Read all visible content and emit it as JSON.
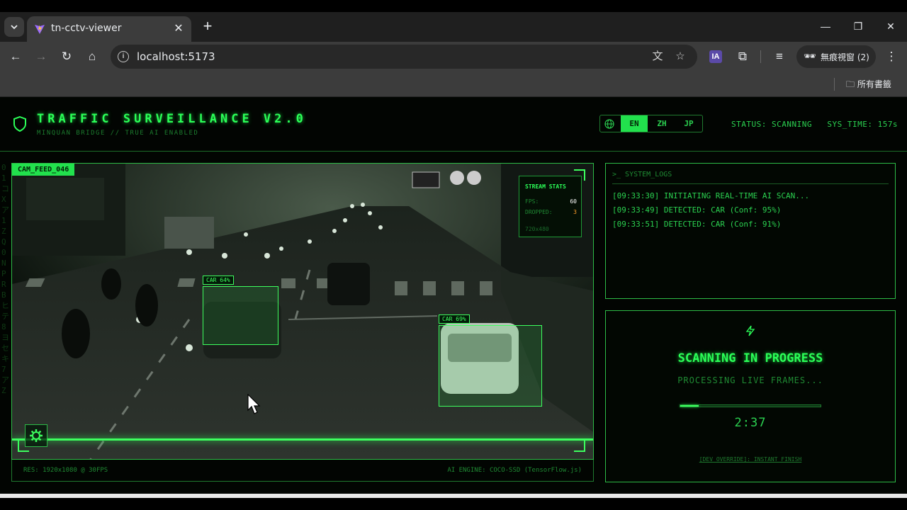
{
  "browser": {
    "tab_title": "tn-cctv-viewer",
    "url": "localhost:5173",
    "incognito_label": "無痕視窗 (2)",
    "bookmarks_label": "所有書籤",
    "extension_label": "IA"
  },
  "header": {
    "title": "TRAFFIC SURVEILLANCE V2.0",
    "subtitle": "MINQUAN BRIDGE // TRUE AI ENABLED",
    "languages": [
      "EN",
      "ZH",
      "JP"
    ],
    "active_language": "EN",
    "status": "STATUS: SCANNING",
    "sys_time": "SYS_TIME: 157s"
  },
  "video": {
    "cam_label": "CAM_FEED_046",
    "stream_stats": {
      "title": "STREAM STATS",
      "fps_label": "FPS:",
      "fps_value": "60",
      "dropped_label": "DROPPED:",
      "dropped_value": "3",
      "resolution": "720x480"
    },
    "detections": [
      {
        "label": "CAR 64%"
      },
      {
        "label": "CAR 69%"
      }
    ],
    "footer_left": "RES: 1920x1080 @ 30FPS",
    "footer_right": "AI ENGINE: COCO-SSD (TensorFlow.js)"
  },
  "logs": {
    "title": ">_ SYSTEM_LOGS",
    "lines": [
      "[09:33:30] INITIATING REAL-TIME AI SCAN...",
      "[09:33:49] DETECTED: CAR (Conf: 95%)",
      "[09:33:51] DETECTED: CAR (Conf: 91%)"
    ]
  },
  "scan": {
    "title": "SCANNING IN PROGRESS",
    "subtitle": "PROCESSING LIVE FRAMES...",
    "progress": 0.13,
    "countdown": "2:37",
    "dev_override": "[DEV_OVERRIDE]: INSTANT_FINISH"
  },
  "colors": {
    "accent": "#2bff58",
    "warning": "#ff9d2a"
  }
}
